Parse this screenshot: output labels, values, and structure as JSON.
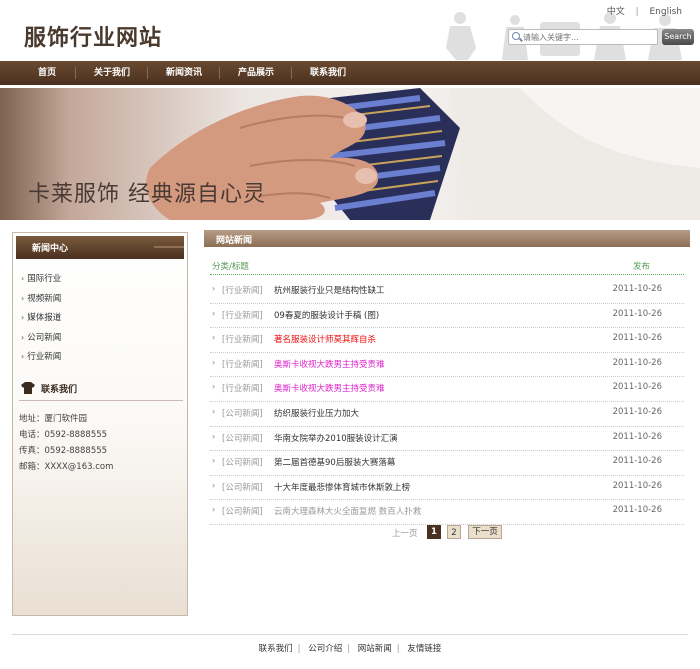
{
  "header": {
    "title": "服饰行业网站",
    "lang_zh": "中文",
    "lang_en": "English",
    "lang_sep": "|",
    "search_placeholder": "请输入关键字...",
    "search_button": "Search"
  },
  "nav": {
    "items": [
      "首页",
      "关于我们",
      "新闻资讯",
      "产品展示",
      "联系我们"
    ]
  },
  "banner": {
    "tagline": "卡莱服饰  经典源自心灵"
  },
  "sidebar": {
    "title": "新闻中心",
    "items": [
      "国际行业",
      "视频新闻",
      "媒体报道",
      "公司新闻",
      "行业新闻"
    ],
    "contact_title": "联系我们",
    "contact": [
      "地址：厦门软件园",
      "电话：0592-8888555",
      "传真：0592-8888555",
      "邮箱：XXXX@163.com"
    ]
  },
  "main": {
    "title": "网站新闻",
    "col_category_title": "分类/标题",
    "col_date": "发布",
    "rows": [
      {
        "category": "[行业新闻]",
        "title": "杭州服装行业只是结构性缺工",
        "date": "2011-10-26",
        "color": "#333333"
      },
      {
        "category": "[行业新闻]",
        "title": "09春夏的服装设计手稿 (图)",
        "date": "2011-10-26",
        "color": "#333333"
      },
      {
        "category": "[行业新闻]",
        "title": "著名服装设计师莫其辉自杀",
        "date": "2011-10-26",
        "color": "#ee1111"
      },
      {
        "category": "[行业新闻]",
        "title": "奥斯卡收视大跌男主持受责难",
        "date": "2011-10-26",
        "color": "#dd22cc"
      },
      {
        "category": "[行业新闻]",
        "title": "奥斯卡收视大跌男主持受责难",
        "date": "2011-10-26",
        "color": "#dd22cc"
      },
      {
        "category": "[公司新闻]",
        "title": "纺织服装行业压力加大",
        "date": "2011-10-26",
        "color": "#333333"
      },
      {
        "category": "[公司新闻]",
        "title": "华南女院举办2010服装设计汇演",
        "date": "2011-10-26",
        "color": "#333333"
      },
      {
        "category": "[公司新闻]",
        "title": "第二届首德基90后服装大赛落幕",
        "date": "2011-10-26",
        "color": "#333333"
      },
      {
        "category": "[公司新闻]",
        "title": "十大年度最悲惨体育城市休斯敦上榜",
        "date": "2011-10-26",
        "color": "#333333"
      },
      {
        "category": "[公司新闻]",
        "title": "云南大理森林大火全面复燃 数百人扑救",
        "date": "2011-10-26",
        "color": "#999999"
      }
    ]
  },
  "pagination": {
    "prev": "上一页",
    "pages": [
      "1",
      "2"
    ],
    "next": "下一页"
  },
  "footer": {
    "links": [
      "联系我们",
      "公司介绍",
      "网站新闻",
      "友情链接"
    ],
    "sep": "|"
  }
}
